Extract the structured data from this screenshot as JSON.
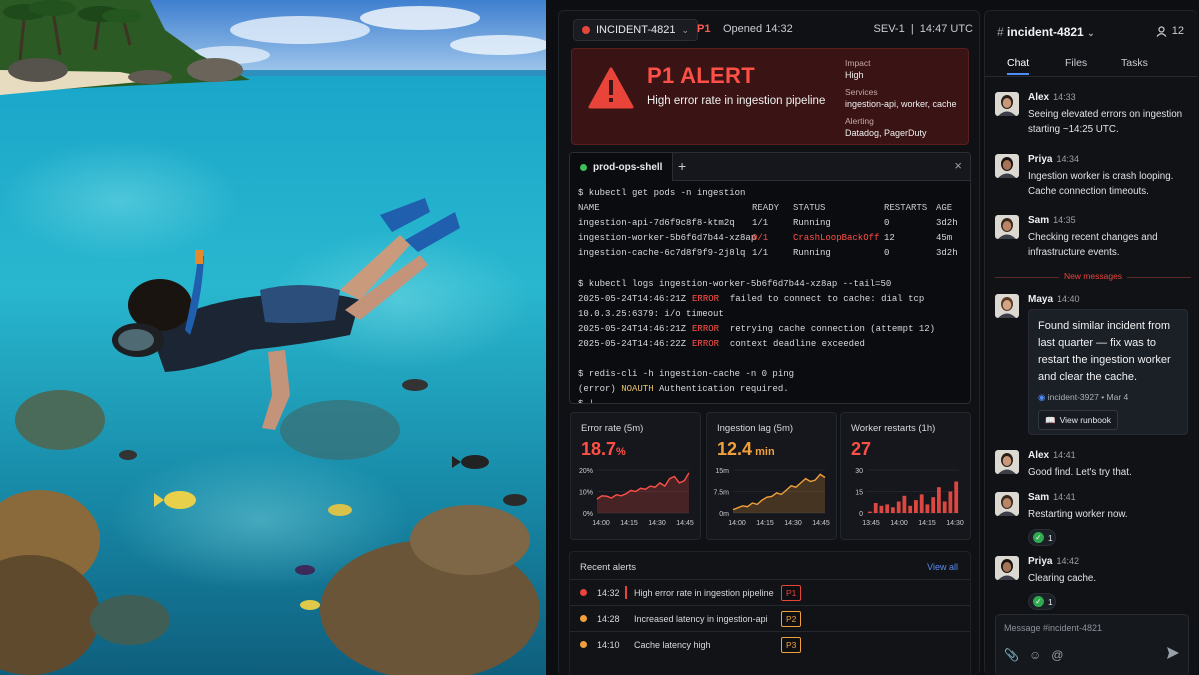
{
  "incident": {
    "id": "INCIDENT-4821",
    "priority": "P1",
    "opened": "Opened 14:32",
    "severity": "SEV-1",
    "time": "14:47 UTC"
  },
  "alert": {
    "title": "P1 ALERT",
    "description": "High error rate in ingestion pipeline",
    "impact_label": "Impact",
    "impact": "High",
    "services_label": "Services",
    "services": "ingestion-api, worker, cache",
    "alerting_label": "Alerting",
    "alerting": "Datadog, PagerDuty"
  },
  "terminal": {
    "tab": "prod-ops-shell",
    "lines": [
      {
        "cmd": "$ kubectl get pods -n ingestion"
      },
      {
        "cols": [
          "NAME",
          "READY",
          "STATUS",
          "RESTARTS",
          "AGE"
        ],
        "header": true
      },
      {
        "cols": [
          "ingestion-api-7d6f9c8f8-ktm2q",
          "1/1",
          "Running",
          "0",
          "3d2h"
        ]
      },
      {
        "cols": [
          "ingestion-worker-5b6f6d7b44-xz8ap",
          "0/1",
          "CrashLoopBackOff",
          "12",
          "45m"
        ],
        "error": true
      },
      {
        "cols": [
          "ingestion-cache-6c7d8f9f9-2j8lq",
          "1/1",
          "Running",
          "0",
          "3d2h"
        ]
      },
      {
        "blank": true
      },
      {
        "cmd": "$ kubectl logs ingestion-worker-5b6f6d7b44-xz8ap --tail=50"
      },
      {
        "ts": "2025-05-24T14:46:21Z",
        "lvl": "ERROR",
        "msg": "  failed to connect to cache: dial tcp"
      },
      {
        "plain": "10.0.3.25:6379: i/o timeout"
      },
      {
        "ts": "2025-05-24T14:46:21Z",
        "lvl": "ERROR",
        "msg": "  retrying cache connection (attempt 12)"
      },
      {
        "ts": "2025-05-24T14:46:22Z",
        "lvl": "ERROR",
        "msg": "  context deadline exceeded"
      },
      {
        "blank": true
      },
      {
        "cmd": "$ redis-cli -h ingestion-cache -n 0 ping"
      },
      {
        "noauth_prefix": "(error) ",
        "noauth": "NOAUTH",
        "noauth_msg": " Authentication required."
      },
      {
        "prompt": "$ |"
      }
    ]
  },
  "metrics": [
    {
      "title": "Error rate (5m)",
      "value": "18.7",
      "unit": "%",
      "color": "#ff5047",
      "chart_data": {
        "type": "area",
        "x": [
          "14:00",
          "14:15",
          "14:30",
          "14:45"
        ],
        "ticks": [
          "20%",
          "10%",
          "0%"
        ],
        "ylim": [
          0,
          20
        ],
        "values": [
          6.5,
          8,
          7.8,
          7,
          8.5,
          8,
          9,
          10.5,
          10,
          11.5,
          11,
          12.5,
          12,
          14,
          12.5,
          16,
          17,
          14,
          15,
          18.7
        ]
      }
    },
    {
      "title": "Ingestion lag (5m)",
      "value": "12.4",
      "unit": " min",
      "color": "#f2a03b",
      "chart_data": {
        "type": "area",
        "x": [
          "14:00",
          "14:15",
          "14:30",
          "14:45"
        ],
        "ticks": [
          "15m",
          "7.5m",
          "0m"
        ],
        "ylim": [
          0,
          15
        ],
        "values": [
          1.2,
          1.8,
          2.5,
          2.2,
          3.5,
          3,
          4.5,
          5.5,
          5.8,
          7,
          6.5,
          8,
          9.5,
          9,
          10.5,
          12,
          11,
          11.5,
          13.5,
          12.4
        ]
      }
    },
    {
      "title": "Worker restarts (1h)",
      "value": "27",
      "unit": "",
      "color": "#ff5047",
      "chart_data": {
        "type": "bar",
        "x": [
          "13:45",
          "14:00",
          "14:15",
          "14:30"
        ],
        "ticks": [
          "30",
          "15",
          "0"
        ],
        "ylim": [
          0,
          30
        ],
        "values": [
          1,
          7,
          5,
          6,
          4,
          8,
          12,
          5,
          9,
          13,
          6,
          11,
          18,
          8,
          15,
          22
        ]
      }
    }
  ],
  "recent": {
    "title": "Recent alerts",
    "view_all": "View all",
    "items": [
      {
        "time": "14:32",
        "name": "High error rate in ingestion pipeline",
        "p": "P1",
        "color": "#e8443a"
      },
      {
        "time": "14:28",
        "name": "Increased latency in ingestion-api",
        "p": "P2",
        "color": "#f2a03b"
      },
      {
        "time": "14:10",
        "name": "Cache latency high",
        "p": "P3",
        "color": "#f2a03b"
      }
    ]
  },
  "chat": {
    "channel": "incident-4821",
    "members": "12",
    "tabs": [
      "Chat",
      "Files",
      "Tasks"
    ],
    "new_messages": "New messages",
    "messages": [
      {
        "name": "Alex",
        "time": "14:33",
        "text": "Seeing elevated errors on ingestion starting ~14:25 UTC."
      },
      {
        "name": "Priya",
        "time": "14:34",
        "text": "Ingestion worker is crash looping. Cache connection timeouts."
      },
      {
        "name": "Sam",
        "time": "14:35",
        "text": "Checking recent changes and infrastructure events."
      },
      {
        "name": "Maya",
        "time": "14:40",
        "text": "Found similar incident from last quarter — fix was to restart the ingestion worker and clear the cache.",
        "ref": "incident-3927",
        "ref_date": "Mar 4",
        "button": "View runbook"
      },
      {
        "name": "Alex",
        "time": "14:41",
        "text": "Good find. Let's try that."
      },
      {
        "name": "Sam",
        "time": "14:41",
        "text": "Restarting worker now.",
        "reaction": "1"
      },
      {
        "name": "Priya",
        "time": "14:42",
        "text": "Clearing cache.",
        "reaction": "1"
      }
    ],
    "composer_placeholder": "Message #incident-4821"
  }
}
